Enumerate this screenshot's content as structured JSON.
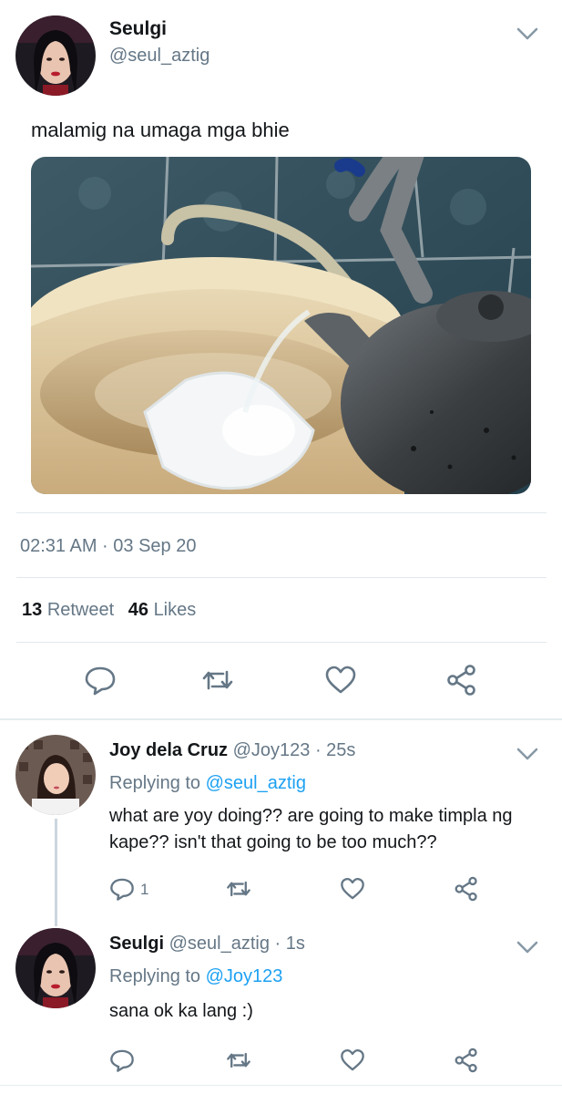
{
  "main_tweet": {
    "display_name": "Seulgi",
    "handle": "@seul_aztig",
    "text": "malamig na umaga mga bhie",
    "photo_icon": "kettle-pouring-water-photo",
    "timestamp": "02:31 AM · 03 Sep 20",
    "retweets": "13",
    "retweets_label": "Retweet",
    "likes": "46",
    "likes_label": "Likes"
  },
  "replies": [
    {
      "display_name": "Joy dela Cruz",
      "handle": "@Joy123",
      "time": "· 25s",
      "replying_prefix": "Replying to",
      "replying_to": "@seul_aztig",
      "text_line1": "what are yoy doing?? are going to make timpla ng",
      "text_line2": "kape?? isn't that going to be too much??",
      "reply_count": "1"
    },
    {
      "display_name": "Seulgi",
      "handle": "@seul_aztig",
      "time": "· 1s",
      "replying_prefix": "Replying to",
      "replying_to": "@Joy123",
      "text_line1": "sana ok ka lang :)",
      "reply_count": ""
    }
  ],
  "icons": [
    "chevron-down-icon",
    "reply-icon",
    "retweet-icon",
    "like-icon",
    "share-icon"
  ],
  "colors": {
    "accent": "#1da1f2",
    "muted": "#657786",
    "divider": "#e1e8ed",
    "icon": "#657786"
  }
}
